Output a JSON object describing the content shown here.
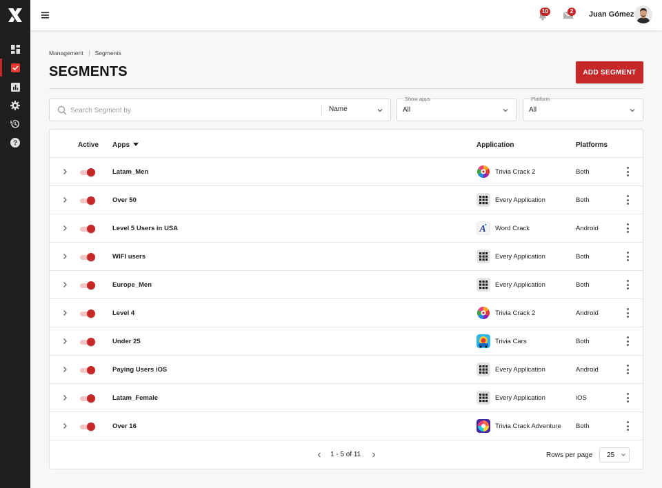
{
  "header": {
    "notifications_count": "10",
    "messages_count": "2",
    "user_name": "Juan Gómez"
  },
  "sidebar": {
    "items": [
      {
        "icon": "dashboard-icon"
      },
      {
        "icon": "checkbox-icon",
        "active": true
      },
      {
        "icon": "bar-chart-icon"
      },
      {
        "icon": "gear-icon"
      },
      {
        "icon": "history-icon"
      },
      {
        "icon": "help-icon"
      }
    ]
  },
  "breadcrumb": [
    "Management",
    "Segments"
  ],
  "page": {
    "title": "SEGMENTS",
    "add_button": "ADD SEGMENT"
  },
  "filters": {
    "search_placeholder": "Search Segment by",
    "search_field": "Name",
    "show_apps_label": "Show apps",
    "show_apps_value": "All",
    "platform_label": "Platform",
    "platform_value": "All"
  },
  "table": {
    "columns": {
      "active": "Active",
      "apps": "Apps",
      "application": "Application",
      "platforms": "Platforms"
    },
    "rows": [
      {
        "name": "Latam_Men",
        "application": "Trivia Crack 2",
        "platform": "Both",
        "app_icon": "trivia-crack-2"
      },
      {
        "name": "Over 50",
        "application": "Every Application",
        "platform": "Both",
        "app_icon": "grid"
      },
      {
        "name": "Level 5 Users in USA",
        "application": "Word Crack",
        "platform": "Android",
        "app_icon": "word-crack"
      },
      {
        "name": "WIFI users",
        "application": "Every Application",
        "platform": "Both",
        "app_icon": "grid"
      },
      {
        "name": "Europe_Men",
        "application": "Every Application",
        "platform": "Both",
        "app_icon": "grid"
      },
      {
        "name": "Level 4",
        "application": "Trivia Crack 2",
        "platform": "Android",
        "app_icon": "trivia-crack-2"
      },
      {
        "name": "Under 25",
        "application": "Trivia Cars",
        "platform": "Both",
        "app_icon": "trivia-cars"
      },
      {
        "name": "Paying Users iOS",
        "application": "Every Application",
        "platform": "Android",
        "app_icon": "grid"
      },
      {
        "name": "Latam_Female",
        "application": "Every Application",
        "platform": "iOS",
        "app_icon": "grid"
      },
      {
        "name": "Over 16",
        "application": "Trivia Crack Adventure",
        "platform": "Both",
        "app_icon": "trivia-crack-adventure"
      }
    ]
  },
  "pagination": {
    "range": "1 - 5 of 11",
    "rows_per_page_label": "Rows per page",
    "rows_per_page_value": "25"
  },
  "colors": {
    "accent": "#c62828",
    "sidebar": "#1e1e1e"
  }
}
